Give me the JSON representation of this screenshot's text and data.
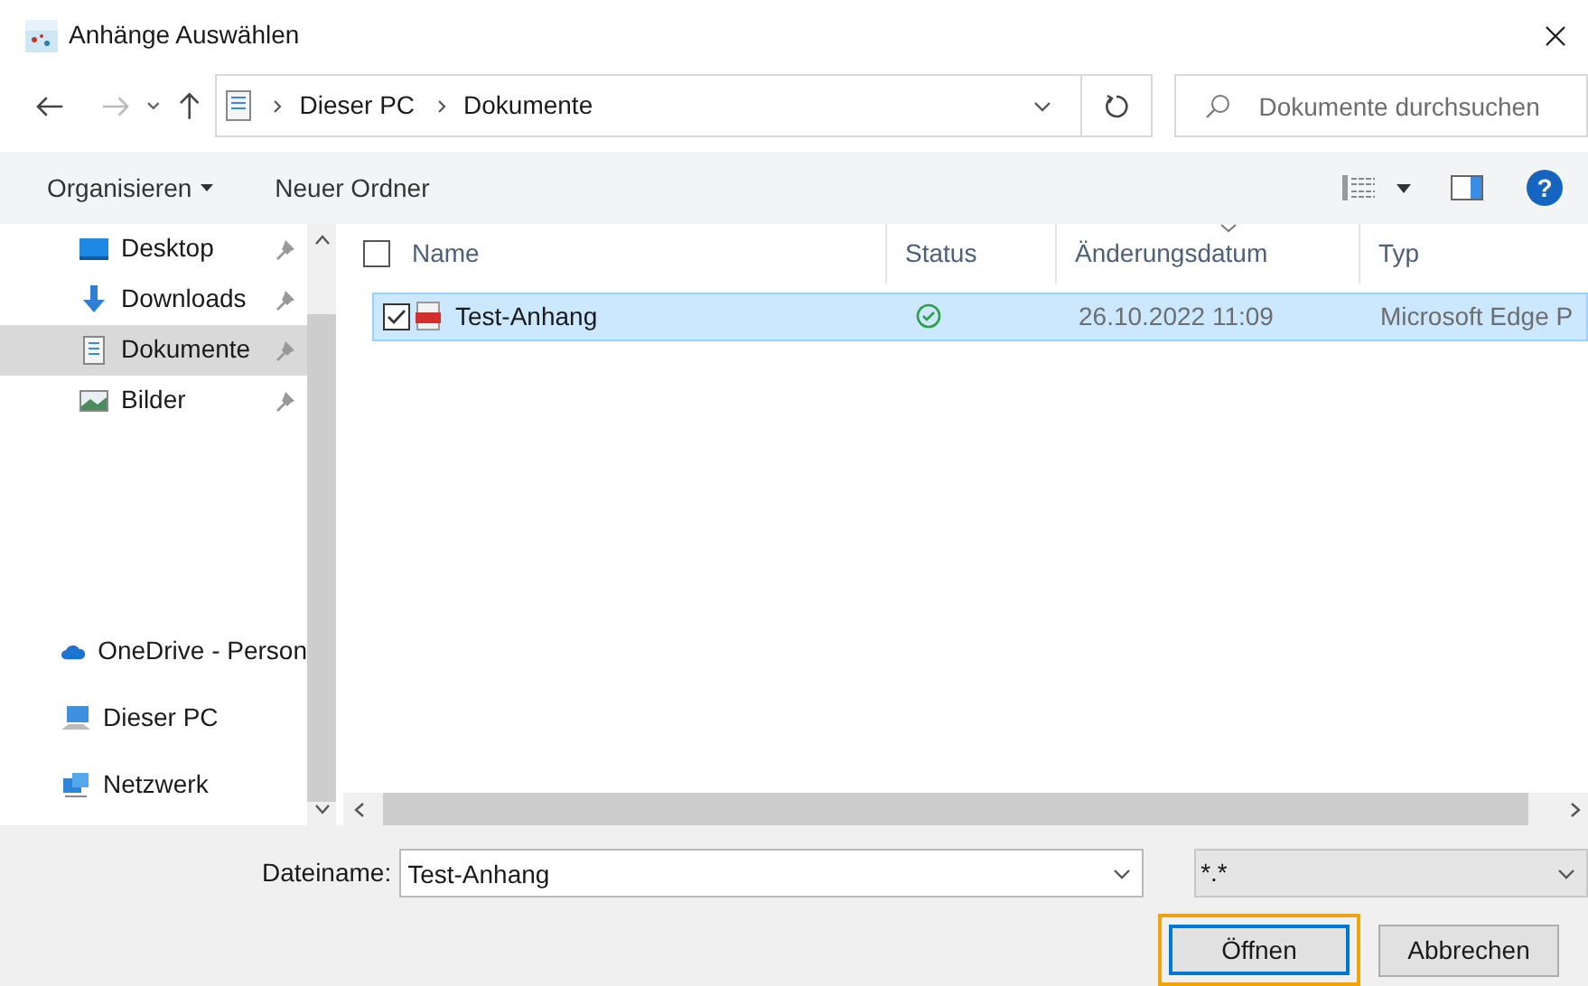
{
  "window": {
    "title": "Anhänge Auswählen"
  },
  "address_bar": {
    "path": [
      "Dieser PC",
      "Dokumente"
    ]
  },
  "search": {
    "placeholder": "Dokumente durchsuchen"
  },
  "toolbar": {
    "items": [
      "Organisieren",
      "Neuer Ordner"
    ],
    "help": "?"
  },
  "sidebar": {
    "items": [
      {
        "label": "Desktop",
        "kind": "desktop",
        "pinned": true,
        "selected": false
      },
      {
        "label": "Downloads",
        "kind": "downloads",
        "pinned": true,
        "selected": false
      },
      {
        "label": "Dokumente",
        "kind": "documents",
        "pinned": true,
        "selected": true
      },
      {
        "label": "Bilder",
        "kind": "pictures",
        "pinned": true,
        "selected": false
      },
      {
        "label": "OneDrive - Person",
        "kind": "onedrive",
        "pinned": false,
        "selected": false
      },
      {
        "label": "Dieser PC",
        "kind": "pc",
        "pinned": false,
        "selected": false
      },
      {
        "label": "Netzwerk",
        "kind": "network",
        "pinned": false,
        "selected": false
      }
    ]
  },
  "table": {
    "select_all_checked": false,
    "columns": [
      "Name",
      "Status",
      "Änderungsdatum",
      "Typ"
    ],
    "rows": [
      {
        "name": "Test-Anhang",
        "date": "26.10.2022 11:09",
        "type": "Microsoft Edge P",
        "checked": true,
        "selected": true
      }
    ]
  },
  "filename": {
    "label": "Dateiname:",
    "value": "Test-Anhang"
  },
  "filter": {
    "value": "*.*"
  },
  "buttons": [
    "Öffnen",
    "Abbrechen"
  ]
}
